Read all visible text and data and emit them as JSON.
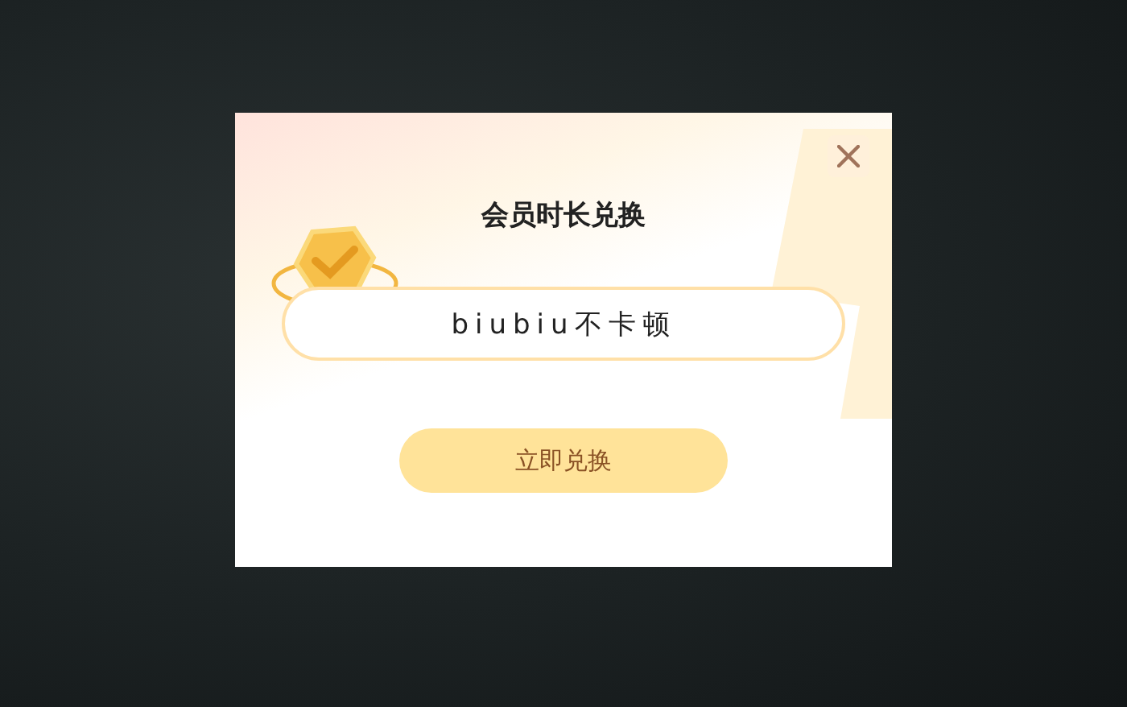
{
  "dialog": {
    "title": "会员时长兑换",
    "code_field": {
      "value": "biubiu不卡顿"
    },
    "button": "立即兑换"
  }
}
